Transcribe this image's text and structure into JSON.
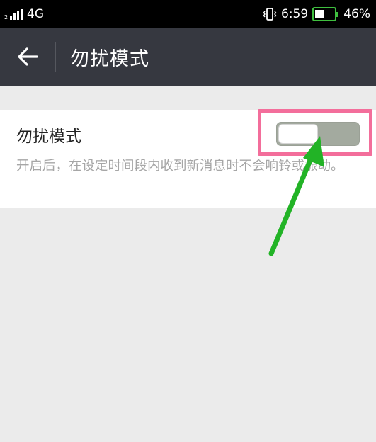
{
  "status_bar": {
    "sim_slot": "2",
    "network": "4G",
    "time": "6:59",
    "battery_percent": "46%",
    "battery_level": 0.46,
    "icons": [
      "signal-icon",
      "vibrate-icon",
      "battery-icon"
    ]
  },
  "header": {
    "back_icon": "back-arrow-icon",
    "title": "勿扰模式"
  },
  "setting": {
    "title": "勿扰模式",
    "description": "开启后，在设定时间段内收到新消息时不会响铃或振动。",
    "toggle_on": false
  },
  "colors": {
    "status_bar": "#000000",
    "title_bar": "#363840",
    "background": "#ebebeb",
    "card": "#ffffff",
    "toggle_track": "#a3aa9f",
    "highlight": "#f36e9b",
    "arrow": "#22b326",
    "battery_border": "#3fbf3f"
  }
}
